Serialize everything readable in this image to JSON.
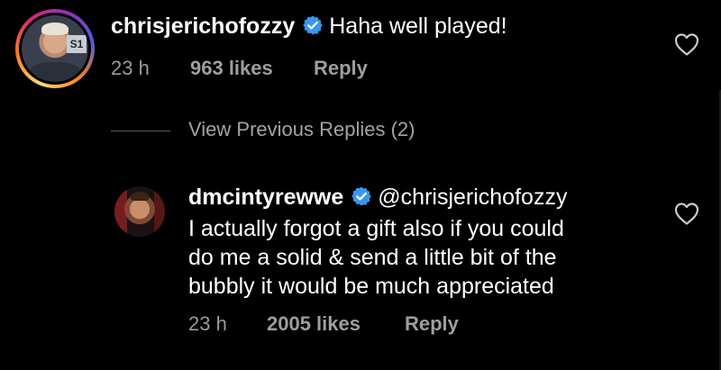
{
  "comments": [
    {
      "username": "chrisjerichofozzy",
      "verified": true,
      "avatar_icon": "profile-photo-chrisjerichofozzy",
      "text": "Haha well played!",
      "time": "23 h",
      "likes": "963 likes",
      "reply_label": "Reply",
      "story_ring": true
    }
  ],
  "view_previous": {
    "label": "View Previous Replies (2)"
  },
  "replies": [
    {
      "username": "dmcintyrewwe",
      "verified": true,
      "avatar_icon": "profile-photo-dmcintyrewwe",
      "mention": "@chrisjerichofozzy",
      "text_lines": [
        "I actually forgot a gift also if you could",
        "do me a solid & send a little bit of the",
        "bubbly it would be much appreciated"
      ],
      "time": "23 h",
      "likes": "2005 likes",
      "reply_label": "Reply"
    }
  ],
  "colors": {
    "background": "#000000",
    "text": "#ffffff",
    "meta": "#9a9a9a",
    "verified_badge": "#3897f0"
  },
  "icons": [
    "verified-badge-icon",
    "heart-outline-icon"
  ]
}
